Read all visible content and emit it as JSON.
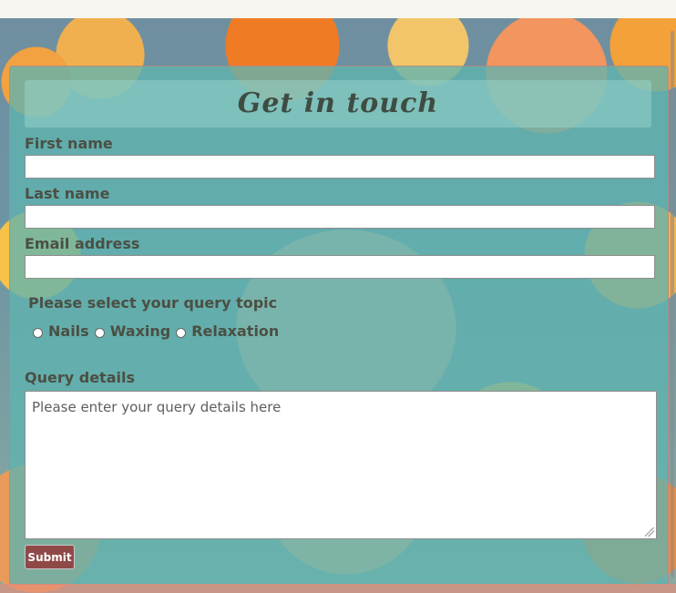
{
  "form": {
    "title": "Get in touch",
    "first_name_label": "First name",
    "last_name_label": "Last name",
    "email_label": "Email address",
    "topic_label": "Please select your query topic",
    "topic_options": [
      "Nails",
      "Waxing",
      "Relaxation"
    ],
    "query_label": "Query details",
    "query_placeholder": "Please enter your query details here",
    "submit_label": "Submit"
  },
  "colors": {
    "panel_accent": "#5fb4af",
    "submit_bg": "#8f4a48",
    "label_text": "#4b4f43"
  }
}
